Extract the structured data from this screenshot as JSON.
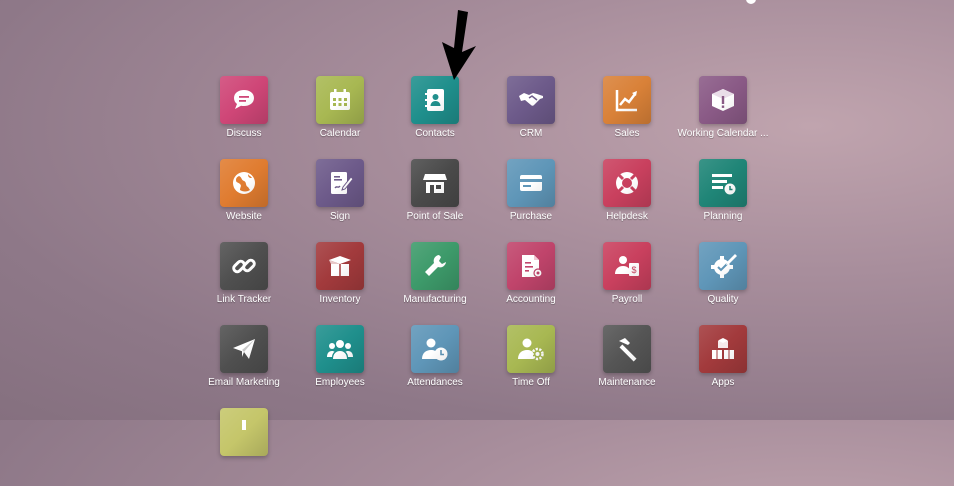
{
  "apps": [
    {
      "label": "Discuss",
      "color": "#cf4677",
      "icon": "chat-bubble-icon"
    },
    {
      "label": "Calendar",
      "color": "#a8b852",
      "icon": "calendar-icon"
    },
    {
      "label": "Contacts",
      "color": "#1f8f8c",
      "icon": "address-book-icon"
    },
    {
      "label": "CRM",
      "color": "#6d5a8a",
      "icon": "handshake-icon"
    },
    {
      "label": "Sales",
      "color": "#d98138",
      "icon": "trending-chart-icon"
    },
    {
      "label": "Working Calendar ...",
      "color": "#8a5a86",
      "icon": "cube-alert-icon"
    },
    {
      "label": "Website",
      "color": "#e07c30",
      "icon": "globe-icon"
    },
    {
      "label": "Sign",
      "color": "#6d5a8a",
      "icon": "sign-document-icon"
    },
    {
      "label": "Point of Sale",
      "color": "#4a4a4a",
      "icon": "storefront-icon"
    },
    {
      "label": "Purchase",
      "color": "#5f96b8",
      "icon": "credit-card-icon"
    },
    {
      "label": "Helpdesk",
      "color": "#c9405e",
      "icon": "lifebuoy-icon"
    },
    {
      "label": "Planning",
      "color": "#1f8577",
      "icon": "list-clock-icon"
    },
    {
      "label": "Link Tracker",
      "color": "#4f4f4f",
      "icon": "link-icon"
    },
    {
      "label": "Inventory",
      "color": "#a23a3c",
      "icon": "open-box-icon"
    },
    {
      "label": "Manufacturing",
      "color": "#3d9a6a",
      "icon": "wrench-icon"
    },
    {
      "label": "Accounting",
      "color": "#c0446b",
      "icon": "invoice-gear-icon"
    },
    {
      "label": "Payroll",
      "color": "#c9405e",
      "icon": "user-dollar-icon"
    },
    {
      "label": "Quality",
      "color": "#5f96b8",
      "icon": "quality-badge-icon"
    },
    {
      "label": "Email Marketing",
      "color": "#4f4f4f",
      "icon": "paper-plane-icon"
    },
    {
      "label": "Employees",
      "color": "#1f8f8c",
      "icon": "users-group-icon"
    },
    {
      "label": "Attendances",
      "color": "#5f96b8",
      "icon": "user-clock-icon"
    },
    {
      "label": "Time Off",
      "color": "#a8b852",
      "icon": "user-gear-icon"
    },
    {
      "label": "Maintenance",
      "color": "#555555",
      "icon": "hammer-icon"
    },
    {
      "label": "Apps",
      "color": "#a23a3c",
      "icon": "cubes-icon"
    },
    {
      "label": "",
      "color": "#c5c66a",
      "icon": "partial-app-icon"
    }
  ]
}
